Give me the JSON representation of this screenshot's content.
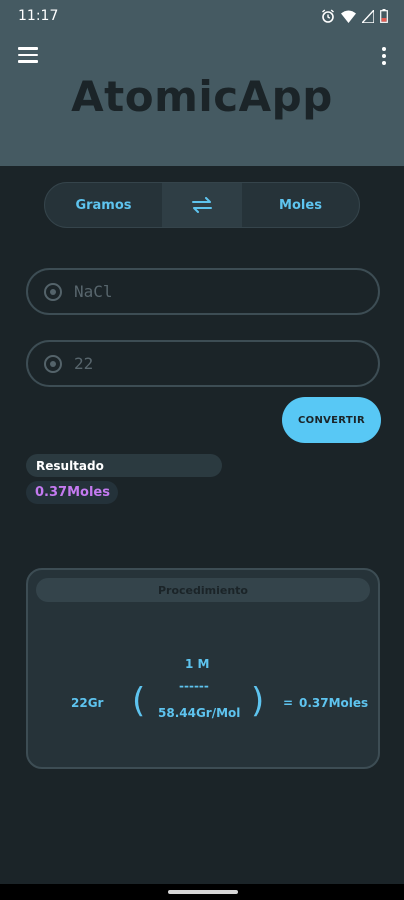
{
  "status": {
    "time": "11:17"
  },
  "app": {
    "title": "AtomicApp"
  },
  "toggle": {
    "left_label": "Gramos",
    "right_label": "Moles",
    "swap_icon": "swap-arrows-icon"
  },
  "form": {
    "compound": {
      "placeholder": "NaCl",
      "value": ""
    },
    "amount": {
      "placeholder": "22",
      "value": ""
    },
    "convert_label": "CONVERTIR"
  },
  "result": {
    "label": "Resultado",
    "value": "0.37Moles"
  },
  "procedure": {
    "title": "Procedimiento",
    "grams": "22Gr",
    "numerator": "1 M",
    "divider": "------",
    "denominator": "58.44Gr/Mol",
    "open_paren": "(",
    "close_paren": ")",
    "equals": "=",
    "result": "0.37Moles"
  },
  "colors": {
    "header_bg": "#455a62",
    "background": "#1b2428",
    "accent": "#5ec4ef",
    "result_value": "#c47af0"
  }
}
